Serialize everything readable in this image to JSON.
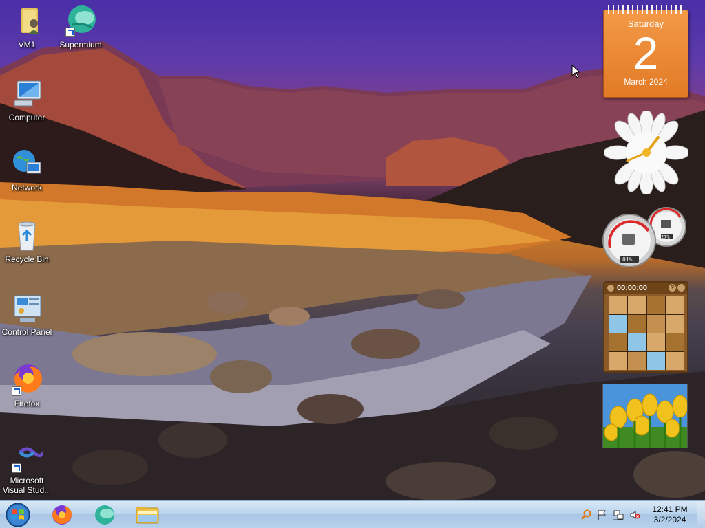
{
  "desktop": {
    "icons": [
      {
        "label": "VM1",
        "icon": "user-folder-icon"
      },
      {
        "label": "Supermium",
        "icon": "supermium-icon"
      },
      {
        "label": "Computer",
        "icon": "computer-icon"
      },
      {
        "label": "Network",
        "icon": "network-icon"
      },
      {
        "label": "Recycle Bin",
        "icon": "recycle-bin-icon"
      },
      {
        "label": "Control Panel",
        "icon": "control-panel-icon"
      },
      {
        "label": "Firefox",
        "icon": "firefox-icon"
      },
      {
        "label": "Microsoft\nVisual Stud...",
        "icon": "visual-studio-icon"
      }
    ]
  },
  "gadgets": {
    "calendar": {
      "weekday": "Saturday",
      "day": "2",
      "month_year": "March 2024"
    },
    "cpu_meter": {
      "cpu": "01%",
      "memory": "27%"
    },
    "puzzle": {
      "timer": "00:00:00"
    }
  },
  "taskbar": {
    "pinned": [
      "firefox-icon",
      "supermium-icon",
      "file-explorer-icon"
    ],
    "tray": [
      "search-icon",
      "action-center-flag-icon",
      "network-icon",
      "volume-muted-icon"
    ],
    "time": "12:41 PM",
    "date": "3/2/2024"
  },
  "colors": {
    "taskbar": "#bcd5ee",
    "calendar": "#e98a35"
  }
}
